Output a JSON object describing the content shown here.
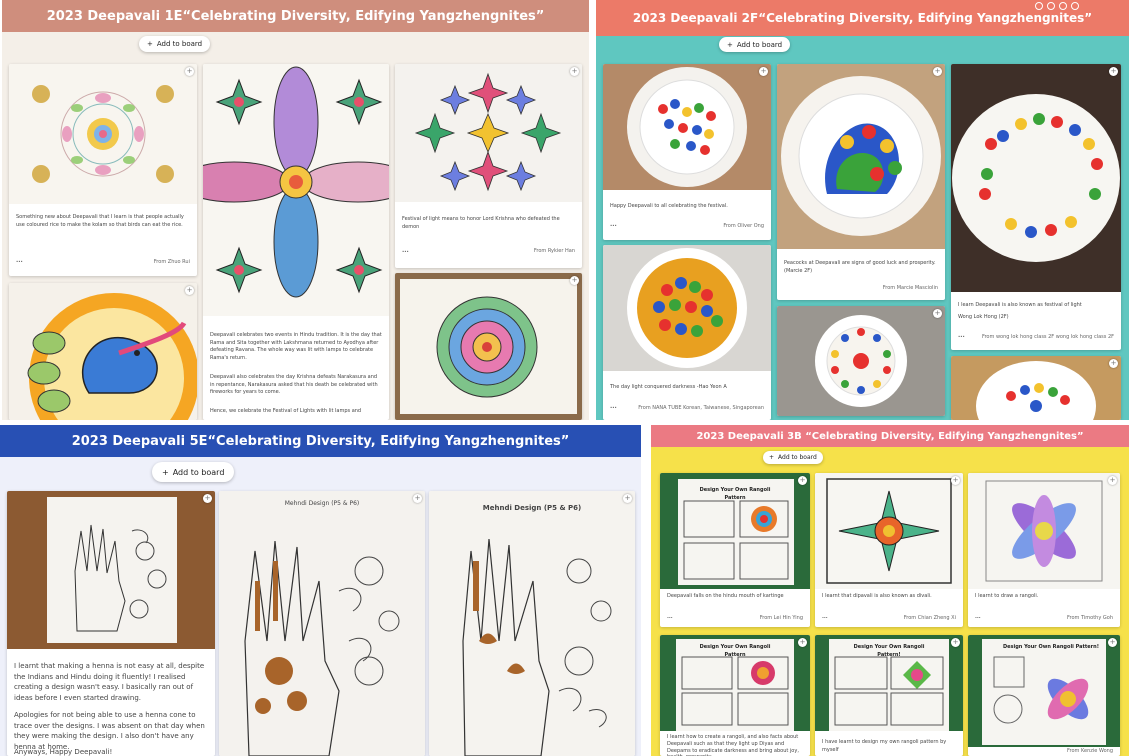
{
  "boards": {
    "b1": {
      "title": "2023 Deepavali 1E“Celebrating Diversity, Edifying Yangzhengnites”",
      "add_label": "Add to board",
      "cards": [
        {
          "text": "Something new about Deepavali that I learn is that people actually use coloured rice to make the kolam so that birds can eat the rice.",
          "more": "...",
          "from": "From Zhuo Rui"
        },
        {
          "text": "Festival of light means to honor Lord Krishna who defeated the demon",
          "more": "...",
          "from": "From Rykier Han"
        },
        {
          "text1": "Deepavali celebrates two events in Hindu tradition. It is the day that Rama and Sita together with Lakshmana returned to Ayodhya after defeating Ravana. The whole way was lit with lamps to celebrate Rama's return.",
          "text2": "Deepavali also celebrates the day Krishna defeats Narakasura and in repentance, Narakasura asked that his death be celebrated with fireworks for years to come.",
          "text3": "Hence, we celebrate the Festival of Lights with lit lamps and"
        }
      ]
    },
    "b2": {
      "title": "2023 Deepavali 2F“Celebrating Diversity, Edifying Yangzhengnites”",
      "add_label": "Add to board",
      "cards": [
        {
          "text": "Happy Deepavali to all celebrating the festival.",
          "more": "...",
          "from": "From Oliver Ong"
        },
        {
          "text": "Peacocks at Deepavali are signs of good luck and prosperity. (Marcie 2F)",
          "more": "...",
          "from": "From Marcie Masciolin"
        },
        {
          "text": "I learn Deepavali is also known as festival of light",
          "text_b": "Wong Lok Hong (2F)",
          "more": "...",
          "from": "From wong lok hong class 2F wong lok hong class 2F"
        },
        {
          "text": "The day light conquered darkness -Hao Yeon A",
          "more": "...",
          "from": "From NANA TUBE Korean, Taiwanese, Singaporean"
        }
      ]
    },
    "b3": {
      "title": "2023 Deepavali 5E“Celebrating Diversity, Edifying Yangzhengnites”",
      "add_label": "Add to board",
      "cards": [
        {
          "p1": "I learnt that making a henna is not easy at all, despite the Indians and Hindu doing it fluently! I realised creating a design wasn't easy. I basically ran out of ideas before I even started drawing.",
          "p2": "Apologies for not being able to use a henna cone to trace over the designs. I was absent on that day when they were making the design. I also don't have any henna at home.",
          "p3": "Anyways, Happy Deepavali!"
        },
        {
          "sheet_title": "Mehndi Design (P5 & P6)"
        },
        {
          "sheet_title": "Mehndi Design (P5 & P6)"
        }
      ]
    },
    "b4": {
      "title": "2023 Deepavali 3B “Celebrating Diversity, Edifying Yangzhengnites”",
      "add_label": "Add to board",
      "cards": [
        {
          "sheet_title": "Design Your Own Rangoli Pattern",
          "text": "Deepavali falls on the hindu mouth of kartinge",
          "more": "...",
          "from": "From Lei Hin Ying"
        },
        {
          "text": "I learnt that dipavali is also known as divali.",
          "more": "...",
          "from": "From Chian Zheng Xi"
        },
        {
          "text": "I learnt to draw a rangoli.",
          "more": "...",
          "from": "From Timothy Goh"
        },
        {
          "sheet_title": "Design Your Own Rangoli Pattern",
          "text": "I learnt how to create a rangoli, and also facts about Deepavali such as that they light up Diyas and Deepams to eradicate darkness and bring about joy, health, prosperity"
        },
        {
          "sheet_title": "Design Your Own Rangoli Pattern!",
          "text": "I have learnt to design my own rangoli pattern by myself"
        },
        {
          "sheet_title": "Design Your Own Rangoli Pattern!",
          "from": "From Kenzie Wong"
        }
      ]
    }
  },
  "colors": {
    "b1_header": "#cf8e7d",
    "b2_header": "#ec7a68",
    "b3_header": "#2850b4",
    "b4_header": "#eb7a83"
  },
  "icons": {
    "add": "plus-icon",
    "card_menu": "plus-circle-icon"
  }
}
